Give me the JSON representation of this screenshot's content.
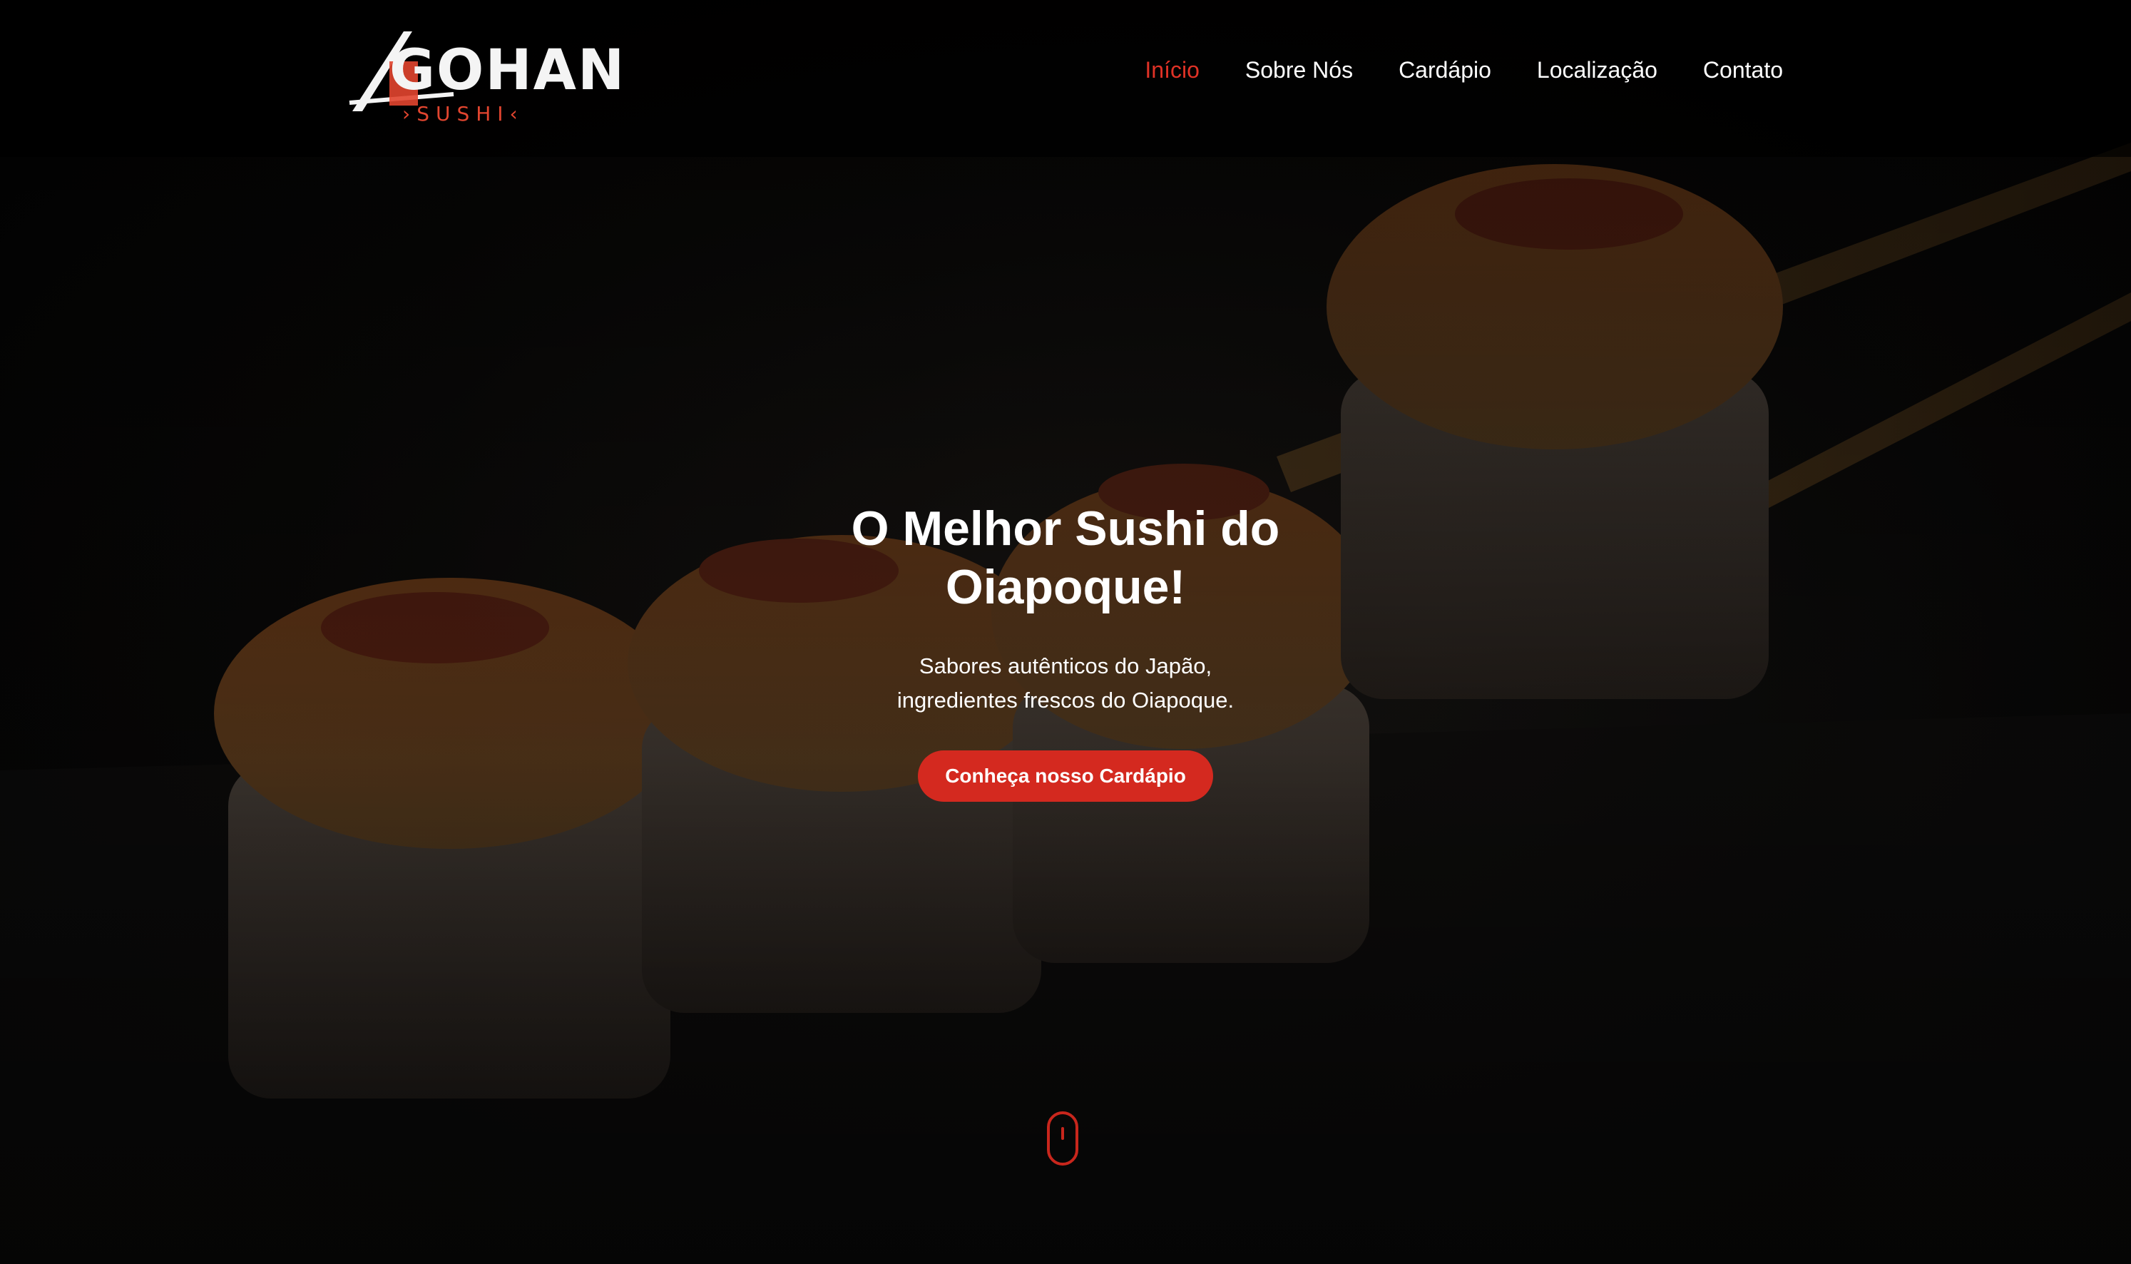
{
  "brand": {
    "logo_main": "GOHAN",
    "logo_sub": "›SUSHI‹",
    "accent_color": "#e03226",
    "button_color": "#d4291f"
  },
  "nav": {
    "items": [
      {
        "label": "Início",
        "active": true
      },
      {
        "label": "Sobre Nós",
        "active": false
      },
      {
        "label": "Cardápio",
        "active": false
      },
      {
        "label": "Localização",
        "active": false
      },
      {
        "label": "Contato",
        "active": false
      }
    ]
  },
  "hero": {
    "title_line1": "O Melhor Sushi do",
    "title_line2": "Oiapoque!",
    "subtitle_line1": "Sabores autênticos do Japão,",
    "subtitle_line2": "ingredientes frescos do Oiapoque.",
    "cta_label": "Conheça nosso Cardápio",
    "background_image": "sushi-rolls-with-chopsticks"
  },
  "scroll": {
    "icon": "mouse-scroll-icon"
  }
}
